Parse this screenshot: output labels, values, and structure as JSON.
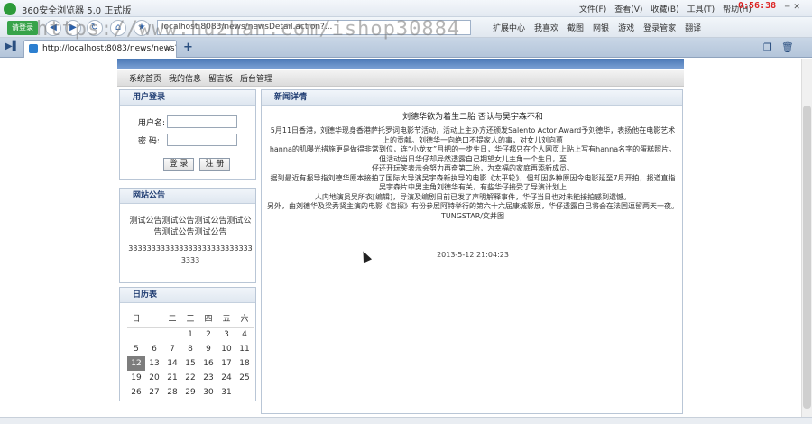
{
  "browser": {
    "title": "360安全浏览器 5.0 正式版",
    "menus": [
      "文件(F)",
      "查看(V)",
      "收藏(B)",
      "工具(T)",
      "帮助(H)"
    ],
    "clock": "0:56:38",
    "login_badge": "请登录",
    "address": "localhost:8083/news/newsDetail.action?...",
    "toolbar_items": [
      "扩展中心",
      "我喜欢",
      "截图",
      "网银",
      "游戏",
      "登录管家",
      "翻译"
    ],
    "tab_title": "http://localhost:8083/news/news?t...",
    "watermark": "https://www.huzhan.com/ishop30884"
  },
  "nav": {
    "items": [
      "系统首页",
      "我的信息",
      "留言板",
      "后台管理"
    ]
  },
  "login_box": {
    "title": "用户登录",
    "username_label": "用户名:",
    "password_label": "密  码:",
    "login_button": "登 录",
    "register_button": "注 册"
  },
  "notice_box": {
    "title": "网站公告",
    "text": "测试公告测试公告测试公告测试公告测试公告测试公告",
    "numbers": "3333333333333333333333333333333"
  },
  "calendar": {
    "title": "日历表",
    "weekdays": [
      "日",
      "一",
      "二",
      "三",
      "四",
      "五",
      "六"
    ],
    "weeks": [
      [
        "",
        "",
        "",
        "1",
        "2",
        "3",
        "4"
      ],
      [
        "5",
        "6",
        "7",
        "8",
        "9",
        "10",
        "11"
      ],
      [
        "12",
        "13",
        "14",
        "15",
        "16",
        "17",
        "18"
      ],
      [
        "19",
        "20",
        "21",
        "22",
        "23",
        "24",
        "25"
      ],
      [
        "26",
        "27",
        "28",
        "29",
        "30",
        "31",
        ""
      ]
    ],
    "today": "12"
  },
  "news": {
    "header": "新闻详情",
    "title": "刘德华欲为着生二胎 否认与吴宇森不和",
    "paragraphs": [
      "5月11日香港，刘德华现身香港萨托罗词电影节活动，活动上主办方还颁发Salento Actor Award予刘德华，表扬他在电影艺术上的贡献。刘德华一向绝口不提家人的事，对女儿刘向蕙",
      "hanna的肌曝光措施更是做得非常到位，连“小龙女”月把的一步生日，华仔都只在个人网页上贴上写有hanna名字的蛋糕照片。但活动当日华仔却异然透露自己期望女儿主角一个生日，至",
      "仔还开玩笑表示会努力再奋第二胎，为幸福的家庭再添新成员。",
      "据到最近有报导指刘德华原本接拍了国际大导演吴宇森新执导的电影《太平轮》，但却因多种原因令电影延至7月开拍，报道直指吴宇森片中男主角刘德华有关，有些华仔接受了导演计划上",
      "人内地演员吴所衣[编辑]，导演及编剧日前已发了声明解释事件，华仔当日也对未能接拍感到遗憾。",
      "另外，由刘德华及梁秀贤主演的电影《盲探》有份参展阿特举行的第六十六届康城影展，华仔透露自己将会在法国逗留两天一夜。TUNGSTAR/文并图"
    ],
    "date": "2013-5-12 21:04:23"
  }
}
